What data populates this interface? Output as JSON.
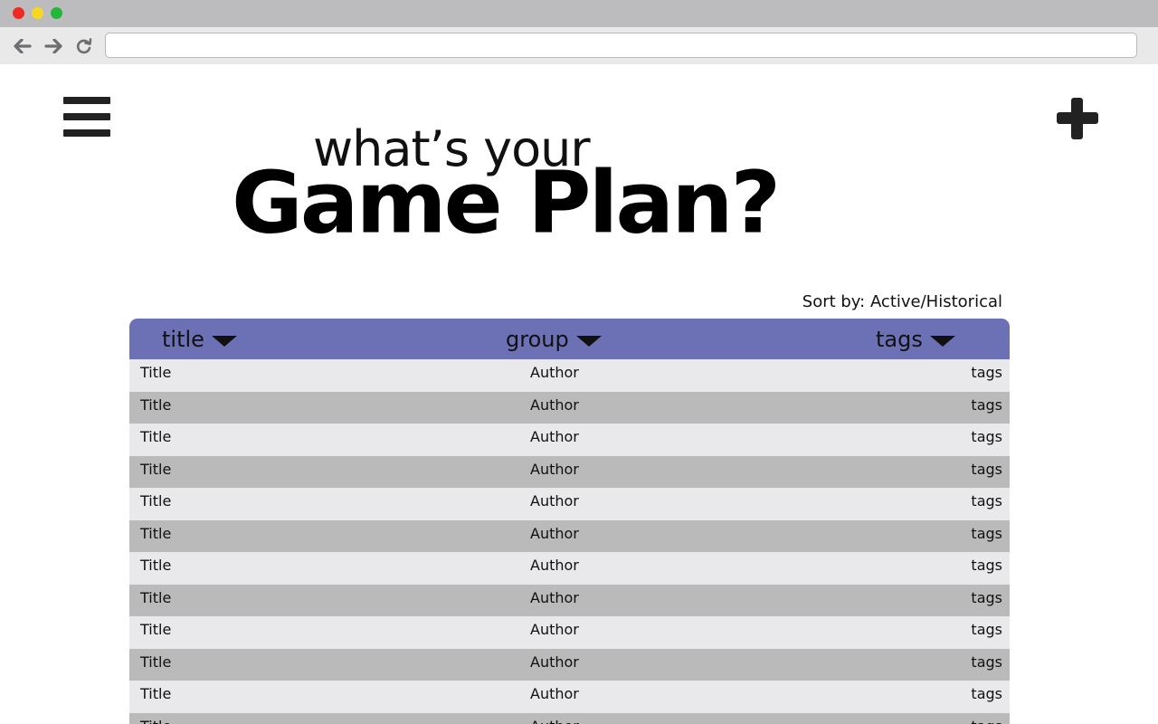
{
  "browser": {
    "address": "",
    "colors": {
      "close": "#ed2a24",
      "minimize": "#f5d81f",
      "maximize": "#27b43a"
    }
  },
  "page": {
    "heading_top": "what’s your",
    "heading_main": "Game Plan?",
    "sort_label": "Sort by: Active/Historical",
    "header_color": "#6c70b5"
  },
  "table": {
    "columns": [
      {
        "label": "title"
      },
      {
        "label": "group"
      },
      {
        "label": "tags"
      }
    ],
    "rows": [
      {
        "title": "Title",
        "author": "Author",
        "tags": "tags"
      },
      {
        "title": "Title",
        "author": "Author",
        "tags": "tags"
      },
      {
        "title": "Title",
        "author": "Author",
        "tags": "tags"
      },
      {
        "title": "Title",
        "author": "Author",
        "tags": "tags"
      },
      {
        "title": "Title",
        "author": "Author",
        "tags": "tags"
      },
      {
        "title": "Title",
        "author": "Author",
        "tags": "tags"
      },
      {
        "title": "Title",
        "author": "Author",
        "tags": "tags"
      },
      {
        "title": "Title",
        "author": "Author",
        "tags": "tags"
      },
      {
        "title": "Title",
        "author": "Author",
        "tags": "tags"
      },
      {
        "title": "Title",
        "author": "Author",
        "tags": "tags"
      },
      {
        "title": "Title",
        "author": "Author",
        "tags": "tags"
      },
      {
        "title": "Title",
        "author": "Author",
        "tags": "tags"
      }
    ]
  },
  "icons": {
    "back": "arrow-left-icon",
    "forward": "arrow-right-icon",
    "reload": "reload-icon",
    "menu": "hamburger-menu-icon",
    "add": "plus-icon",
    "sort_caret": "caret-down-icon"
  }
}
